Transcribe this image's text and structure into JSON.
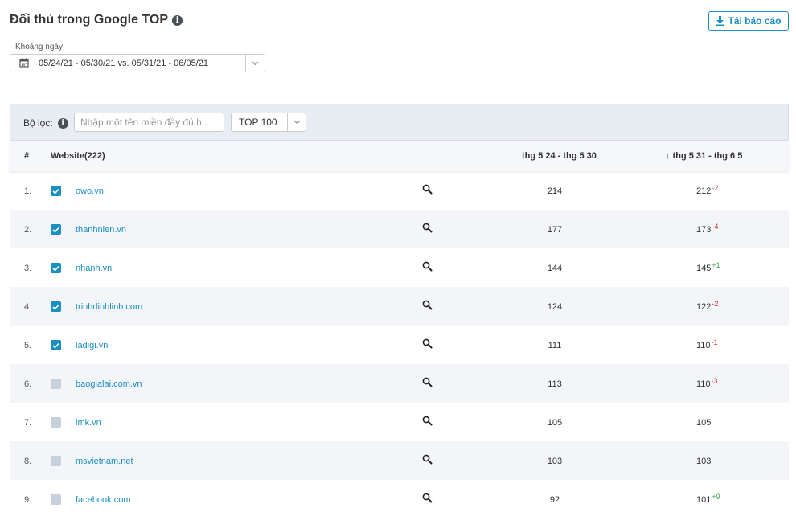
{
  "header": {
    "title": "Đối thủ trong Google TOP",
    "download_label": "Tải báo cáo"
  },
  "date_range": {
    "label": "Khoảng ngày",
    "value": "05/24/21 - 05/30/21 vs. 05/31/21 - 06/05/21"
  },
  "filter": {
    "label": "Bộ lọc:",
    "placeholder": "Nhập một tên miền đầy đủ h...",
    "top_value": "TOP 100"
  },
  "table": {
    "columns": {
      "index": "#",
      "website": "Website(222)",
      "prev": "thg 5 24 - thg 5 30",
      "curr": "↓ thg 5 31 - thg 6 5"
    },
    "rows": [
      {
        "idx": "1.",
        "site": "owo.vn",
        "checked": true,
        "prev": "214",
        "curr": "212",
        "delta": "-2"
      },
      {
        "idx": "2.",
        "site": "thanhnien.vn",
        "checked": true,
        "prev": "177",
        "curr": "173",
        "delta": "-4"
      },
      {
        "idx": "3.",
        "site": "nhanh.vn",
        "checked": true,
        "prev": "144",
        "curr": "145",
        "delta": "+1"
      },
      {
        "idx": "4.",
        "site": "trinhdinhlinh.com",
        "checked": true,
        "prev": "124",
        "curr": "122",
        "delta": "-2"
      },
      {
        "idx": "5.",
        "site": "ladigi.vn",
        "checked": true,
        "prev": "111",
        "curr": "110",
        "delta": "-1"
      },
      {
        "idx": "6.",
        "site": "baogialai.com.vn",
        "checked": false,
        "prev": "113",
        "curr": "110",
        "delta": "-3"
      },
      {
        "idx": "7.",
        "site": "imk.vn",
        "checked": false,
        "prev": "105",
        "curr": "105",
        "delta": ""
      },
      {
        "idx": "8.",
        "site": "msvietnam.net",
        "checked": false,
        "prev": "103",
        "curr": "103",
        "delta": ""
      },
      {
        "idx": "9.",
        "site": "facebook.com",
        "checked": false,
        "prev": "92",
        "curr": "101",
        "delta": "+9"
      }
    ]
  },
  "colors": {
    "accent": "#1a8fc2",
    "negative": "#d0342c",
    "positive": "#3aa757"
  }
}
